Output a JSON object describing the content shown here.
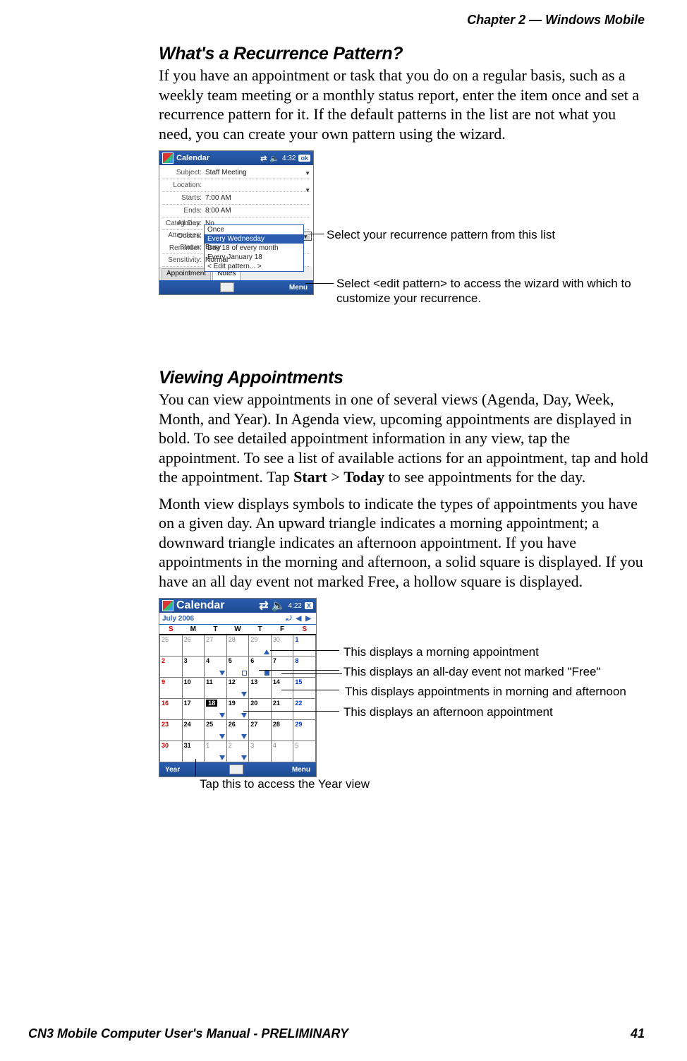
{
  "header": {
    "chapter": "Chapter 2 —  Windows Mobile"
  },
  "footer": {
    "manual": "CN3 Mobile Computer User's Manual - PRELIMINARY",
    "page": "41"
  },
  "section1": {
    "title": "What's a Recurrence Pattern?",
    "para": "If you have an appointment or task that you do on a regular basis, such as a weekly team meeting or a monthly status report, enter the item once and set a recurrence pattern for it. If the default patterns in the list are not what you need, you can create your own pattern using the wizard."
  },
  "editshot": {
    "title": "Calendar",
    "clock": "4:32",
    "ok": "ok",
    "rows": {
      "subject_lbl": "Subject:",
      "subject_val": "Staff Meeting",
      "location_lbl": "Location:",
      "location_val": "",
      "starts_lbl": "Starts:",
      "starts_val": "7:00 AM",
      "ends_lbl": "Ends:",
      "ends_val": "8:00 AM",
      "allday_lbl": "All Day:",
      "allday_val": "No",
      "occurs_lbl": "Occurs:",
      "occurs_val": "Every Wednesday",
      "reminder_lbl": "Reminder:",
      "categories_lbl": "Categories:",
      "attendees_lbl": "Attendees:",
      "status_lbl": "Status:",
      "status_val": "Busy",
      "sensitivity_lbl": "Sensitivity:",
      "sensitivity_val": "Normal"
    },
    "dropdown": {
      "opt1": "Once",
      "opt2": "Every Wednesday",
      "opt3": "Day 18 of every month",
      "opt4": "Every January 18",
      "opt5": "< Edit pattern... >"
    },
    "tabs": {
      "t1": "Appointment",
      "t2": "Notes"
    },
    "menu": "Menu"
  },
  "editcallouts": {
    "c1": "Select your recurrence pattern from this list",
    "c2": "Select <edit pattern> to access the wizard with which to customize your recurrence."
  },
  "section2": {
    "title": "Viewing Appointments",
    "para1a": "You can view appointments in one of several views (Agenda, Day, Week, Month, and Year). In Agenda view, upcoming appointments are displayed in bold. To see detailed appointment information in any view, tap the appointment. To see a list of available actions for an appointment, tap and hold the appointment. Tap ",
    "para1_start": "Start",
    "para1_gt": " > ",
    "para1_today": "Today",
    "para1b": " to see appointments for the day.",
    "para2": "Month view displays symbols to indicate the types of appointments you have on a given day. An upward triangle indicates a morning appointment; a downward triangle indicates an afternoon appointment. If you have appointments in the morning and afternoon, a solid square is displayed. If you have an all day event not marked Free, a hollow square is displayed."
  },
  "monthshot": {
    "title": "Calendar",
    "clock": "4:22",
    "close": "X",
    "monthyear": "July 2006",
    "dow": [
      "S",
      "M",
      "T",
      "W",
      "T",
      "F",
      "S"
    ],
    "weeks": [
      [
        {
          "n": "25",
          "cls": "othermonth red"
        },
        {
          "n": "26",
          "cls": "othermonth"
        },
        {
          "n": "27",
          "cls": "othermonth"
        },
        {
          "n": "28",
          "cls": "othermonth"
        },
        {
          "n": "29",
          "cls": "othermonth",
          "mark": "up"
        },
        {
          "n": "30",
          "cls": "othermonth"
        },
        {
          "n": "1",
          "cls": "blue"
        }
      ],
      [
        {
          "n": "2",
          "cls": "red"
        },
        {
          "n": "3"
        },
        {
          "n": "4",
          "mark": "down"
        },
        {
          "n": "5",
          "mark": "hollow"
        },
        {
          "n": "6",
          "mark": "solid"
        },
        {
          "n": "7"
        },
        {
          "n": "8",
          "cls": "blue"
        }
      ],
      [
        {
          "n": "9",
          "cls": "red"
        },
        {
          "n": "10"
        },
        {
          "n": "11"
        },
        {
          "n": "12",
          "mark": "down"
        },
        {
          "n": "13"
        },
        {
          "n": "14"
        },
        {
          "n": "15",
          "cls": "blue"
        }
      ],
      [
        {
          "n": "16",
          "cls": "red"
        },
        {
          "n": "17"
        },
        {
          "n": "18",
          "cls": "today",
          "mark": "down"
        },
        {
          "n": "19",
          "mark": "down"
        },
        {
          "n": "20"
        },
        {
          "n": "21"
        },
        {
          "n": "22",
          "cls": "blue"
        }
      ],
      [
        {
          "n": "23",
          "cls": "red"
        },
        {
          "n": "24"
        },
        {
          "n": "25",
          "mark": "down"
        },
        {
          "n": "26",
          "mark": "down"
        },
        {
          "n": "27"
        },
        {
          "n": "28"
        },
        {
          "n": "29",
          "cls": "blue"
        }
      ],
      [
        {
          "n": "30",
          "cls": "red"
        },
        {
          "n": "31"
        },
        {
          "n": "1",
          "cls": "othermonth",
          "mark": "down"
        },
        {
          "n": "2",
          "cls": "othermonth",
          "mark": "down"
        },
        {
          "n": "3",
          "cls": "othermonth"
        },
        {
          "n": "4",
          "cls": "othermonth"
        },
        {
          "n": "5",
          "cls": "othermonth blue"
        }
      ]
    ],
    "year": "Year",
    "menu": "Menu"
  },
  "monthcallouts": {
    "c1": "This displays a morning appointment",
    "c2": "This displays an all-day event not marked \"Free\"",
    "c3": "This displays appointments in morning and afternoon",
    "c4": "This displays an afternoon appointment",
    "c5": "Tap this to access the Year view"
  }
}
